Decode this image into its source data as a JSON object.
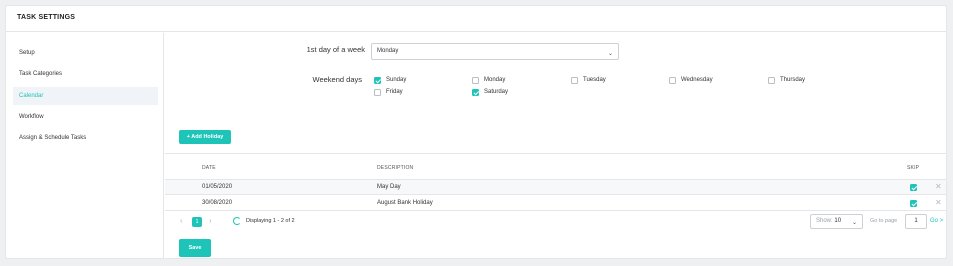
{
  "header": {
    "title": "TASK SETTINGS"
  },
  "sidebar": {
    "items": [
      {
        "label": "Setup"
      },
      {
        "label": "Task Categories"
      },
      {
        "label": "Calendar"
      },
      {
        "label": "Workflow"
      },
      {
        "label": "Assign & Schedule Tasks"
      }
    ]
  },
  "form": {
    "first_day_label": "1st day of a week",
    "first_day_value": "Monday",
    "weekend_label": "Weekend days",
    "days": [
      {
        "label": "Sunday",
        "checked": true
      },
      {
        "label": "Monday",
        "checked": false
      },
      {
        "label": "Tuesday",
        "checked": false
      },
      {
        "label": "Wednesday",
        "checked": false
      },
      {
        "label": "Thursday",
        "checked": false
      },
      {
        "label": "Friday",
        "checked": false
      },
      {
        "label": "Saturday",
        "checked": true
      }
    ]
  },
  "add_holiday_label": "+ Add Holiday",
  "table": {
    "columns": {
      "date": "DATE",
      "description": "DESCRIPTION",
      "skip": "SKIP"
    },
    "rows": [
      {
        "date": "01/05/2020",
        "description": "May Day",
        "skip": true
      },
      {
        "date": "30/08/2020",
        "description": "August Bank Holiday",
        "skip": true
      }
    ],
    "delete_glyph": "✕"
  },
  "pagination": {
    "prev": "‹",
    "current": "1",
    "next": "›",
    "displaying": "Displaying 1 - 2 of 2",
    "show_label": "Show:",
    "show_value": "10",
    "goto_label": "Go to page",
    "goto_value": "1",
    "go_label": "Go >"
  },
  "save_label": "Save",
  "colors": {
    "accent": "#1ec4b8",
    "active_bg": "#f0f3f7",
    "border": "#e4e6ea"
  },
  "icons": {
    "chevron": "chevron-down-icon",
    "refresh": "refresh-icon",
    "delete": "close-icon"
  }
}
